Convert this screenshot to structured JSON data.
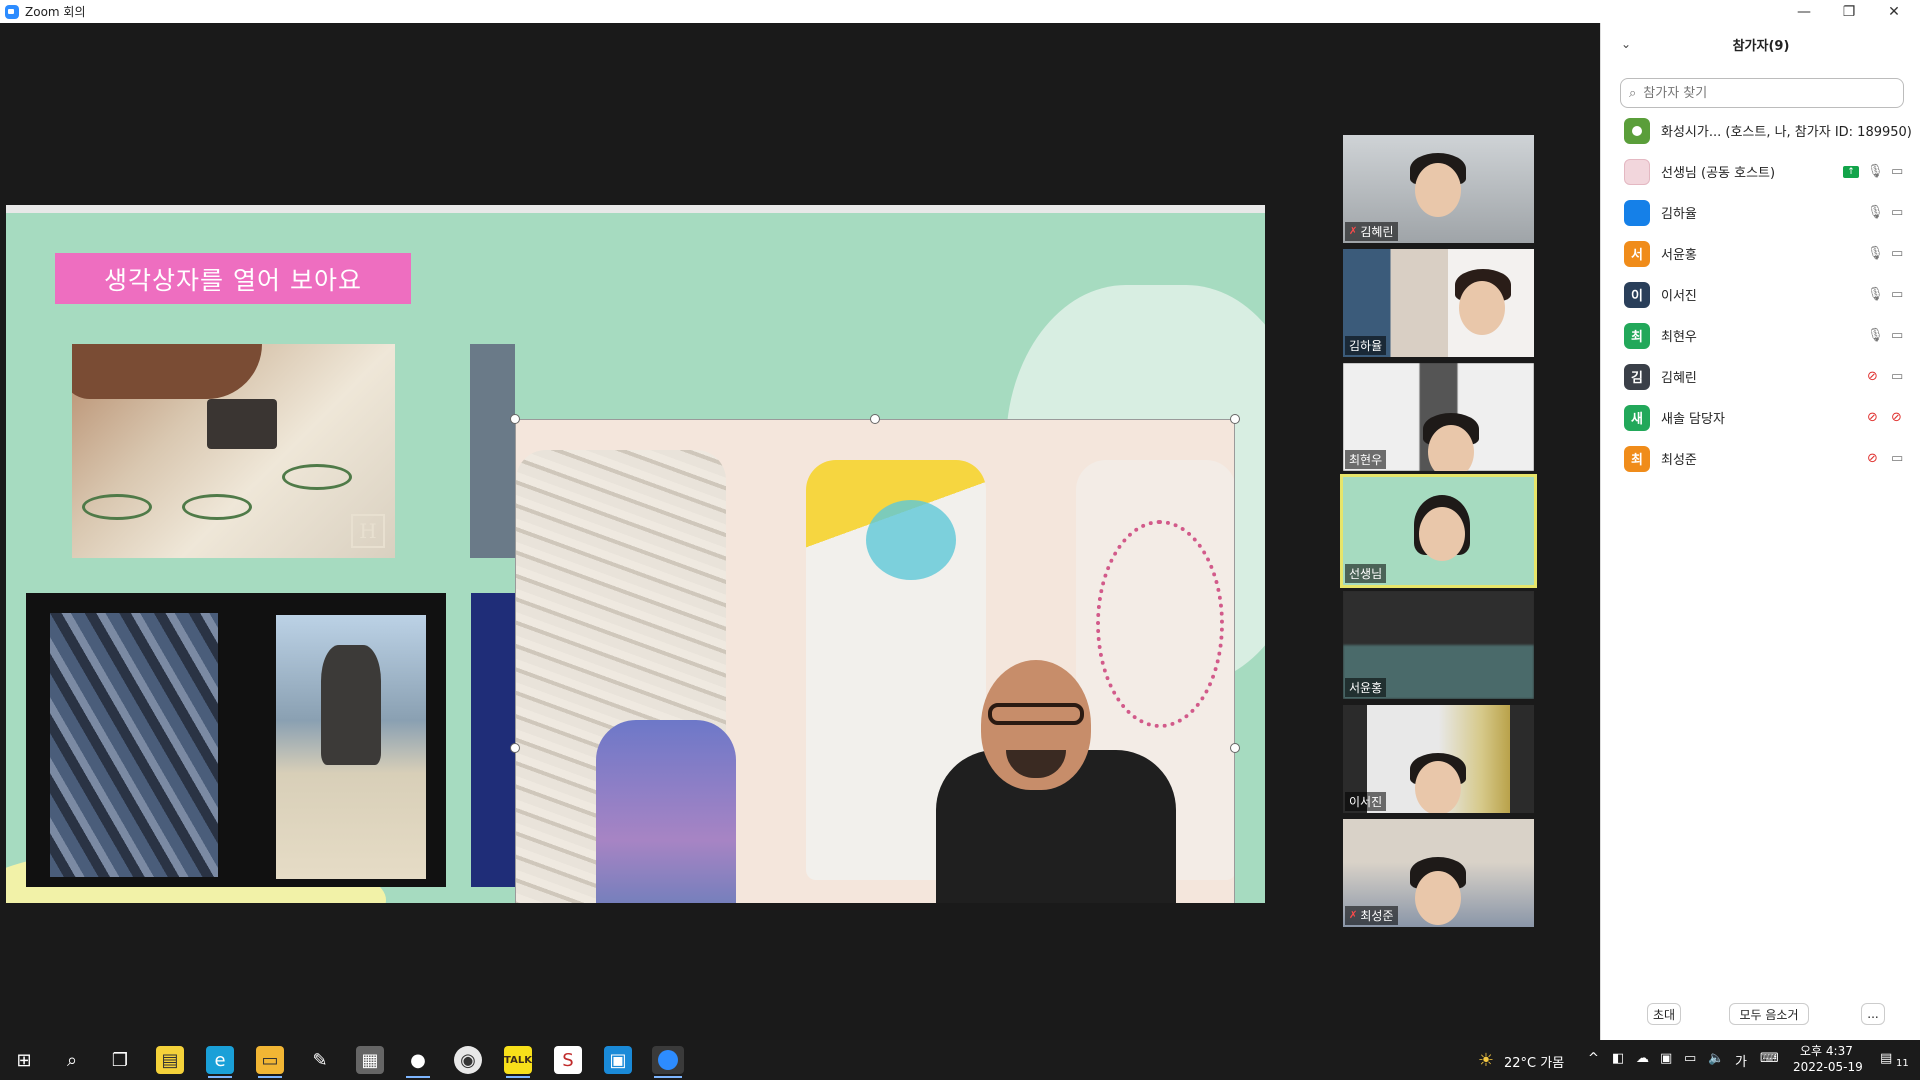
{
  "window": {
    "title": "Zoom 회의",
    "minimize": "—",
    "restore": "❐",
    "close": "✕"
  },
  "slide": {
    "title": "생각상자를 열어 보아요",
    "watermark": "H"
  },
  "gallery": [
    {
      "name": "김혜린",
      "muted": true
    },
    {
      "name": "김하율",
      "muted": false
    },
    {
      "name": "최현우",
      "muted": false
    },
    {
      "name": "선생님",
      "muted": false,
      "active": true
    },
    {
      "name": "서윤홍",
      "muted": false
    },
    {
      "name": "이서진",
      "muted": false
    },
    {
      "name": "최성준",
      "muted": true
    }
  ],
  "participants_panel": {
    "title": "참가자(9)",
    "collapse_icon": "⌄",
    "search_placeholder": "참가자 찾기",
    "list": [
      {
        "avatar": "",
        "avatar_color": "#5a9e3a",
        "name": "화성시가...  (호스트, 나, 참가자 ID: 189950)",
        "id": ""
      },
      {
        "avatar": "",
        "avatar_color": "#f2d6dc",
        "name": "선생님 (공동 호스트)"
      },
      {
        "avatar": "",
        "avatar_color": "#1580e8",
        "name": "김하율"
      },
      {
        "avatar": "서",
        "avatar_color": "#f08c1a",
        "name": "서윤홍"
      },
      {
        "avatar": "이",
        "avatar_color": "#2a3f5a",
        "name": "이서진"
      },
      {
        "avatar": "최",
        "avatar_color": "#22a85a",
        "name": "최현우"
      },
      {
        "avatar": "김",
        "avatar_color": "#3a3f48",
        "name": "김혜린"
      },
      {
        "avatar": "새",
        "avatar_color": "#22a85a",
        "name": "새솔 담당자"
      },
      {
        "avatar": "최",
        "avatar_color": "#f08c1a",
        "name": "최성준"
      }
    ],
    "footer": {
      "invite": "초대",
      "mute_all": "모두 음소거",
      "more": "..."
    }
  },
  "taskbar": {
    "weather": "22°C  가몸",
    "ime": "가",
    "clock_time": "오후 4:37",
    "clock_date": "2022-05-19",
    "notifications": "11"
  }
}
